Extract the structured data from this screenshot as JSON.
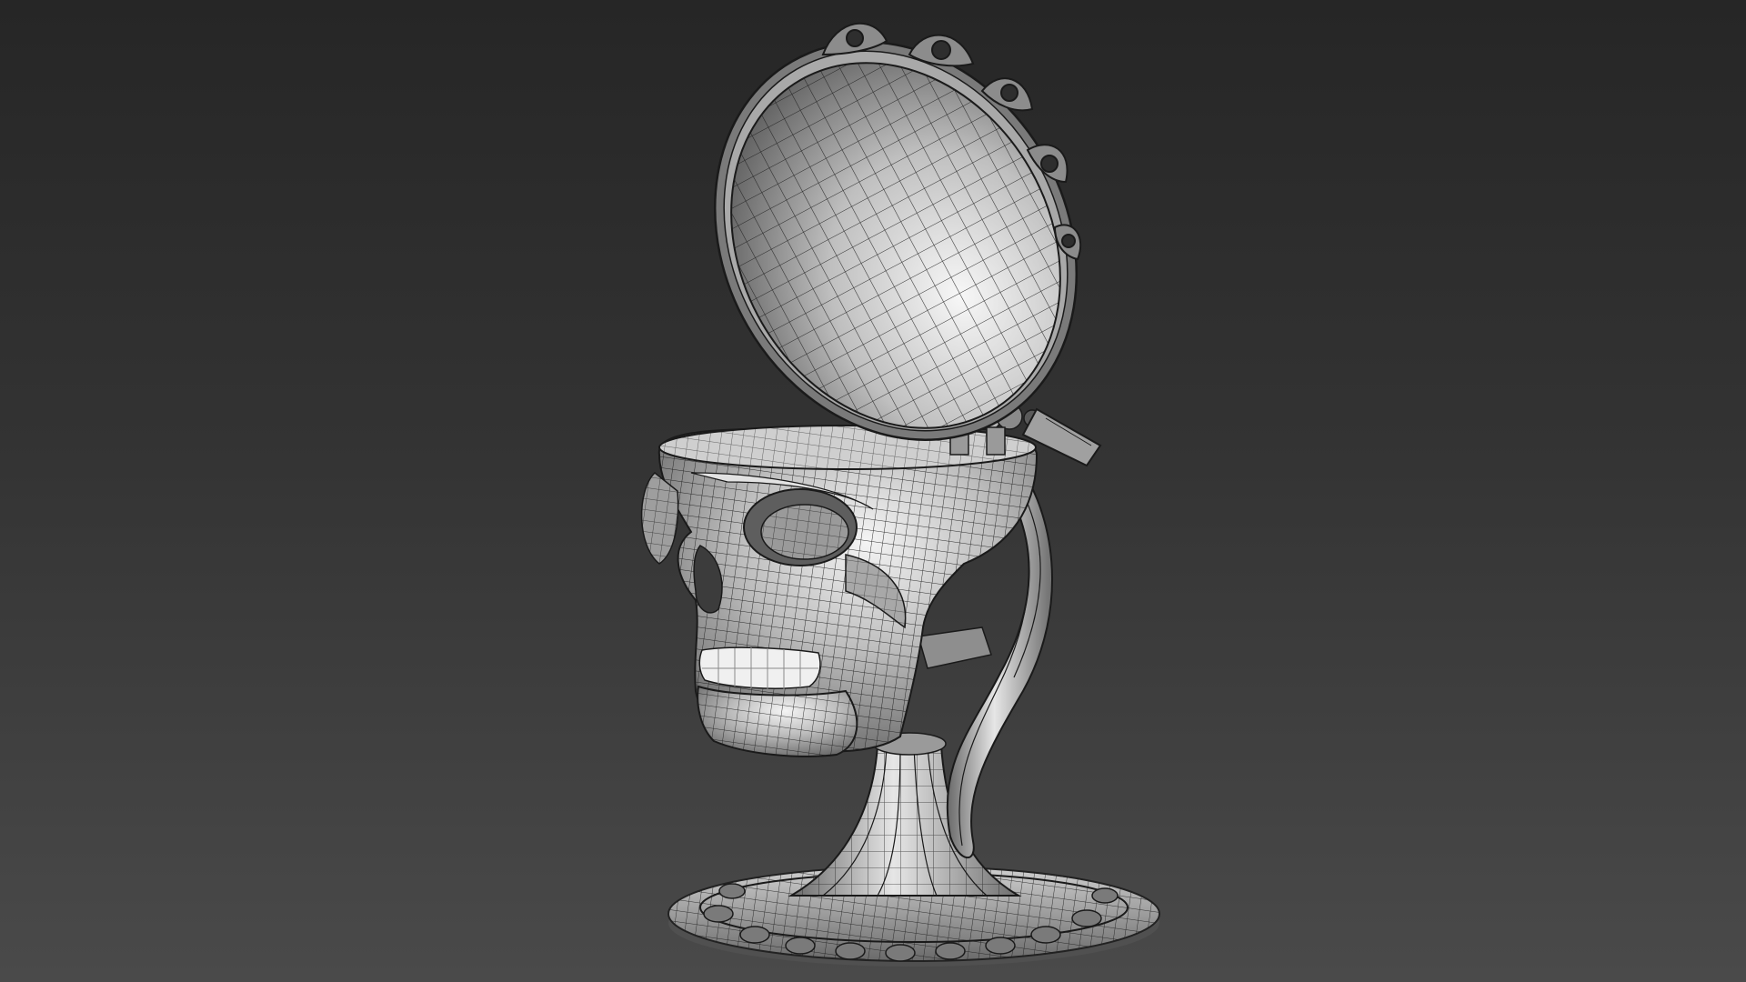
{
  "viewport": {
    "background_top": "#262626",
    "background_bottom": "#4a4a4a",
    "shading_mode": "smooth-shaded-wireframe"
  },
  "model": {
    "icon": "skull-chalice-model-icon",
    "surface_color": "#b9b9b9",
    "wire_color": "#1a1a1a",
    "highlight_color": "#f2f2f2"
  }
}
